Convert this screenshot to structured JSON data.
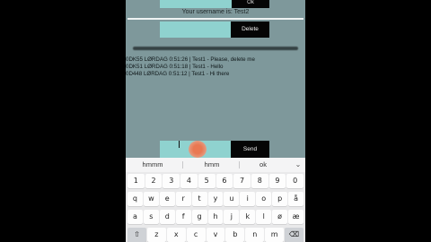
{
  "top_bar": {
    "ok_label": "Ok"
  },
  "username": {
    "text": "Your username is: Test2"
  },
  "delete_bar": {
    "delete_label": "Delete"
  },
  "messages": [
    "0DK55 LØRDAG 0:51:26 | Test1 - Please, delete me",
    "0DK51 LØRDAG 0:51:18 | Test1 - Hello",
    "0D448 LØRDAG 0:51:12 | Test1 - Hi there"
  ],
  "send_bar": {
    "input_value": "",
    "send_label": "Send"
  },
  "keyboard": {
    "suggestions": [
      "hmmm",
      "hmm",
      "ok"
    ],
    "chevron": "⌄",
    "row1": [
      "1",
      "2",
      "3",
      "4",
      "5",
      "6",
      "7",
      "8",
      "9",
      "0"
    ],
    "row2": [
      "q",
      "w",
      "e",
      "r",
      "t",
      "y",
      "u",
      "i",
      "o",
      "p",
      "å"
    ],
    "row3": [
      "a",
      "s",
      "d",
      "f",
      "g",
      "h",
      "j",
      "k",
      "l",
      "ø",
      "æ"
    ],
    "row4": [
      "⇧",
      "z",
      "x",
      "c",
      "v",
      "b",
      "n",
      "m",
      "⌫"
    ]
  },
  "colors": {
    "background": "#7e989b",
    "input_fill": "#8fd2cf",
    "button_fill": "#050505",
    "touch_indicator": "#e97852"
  }
}
